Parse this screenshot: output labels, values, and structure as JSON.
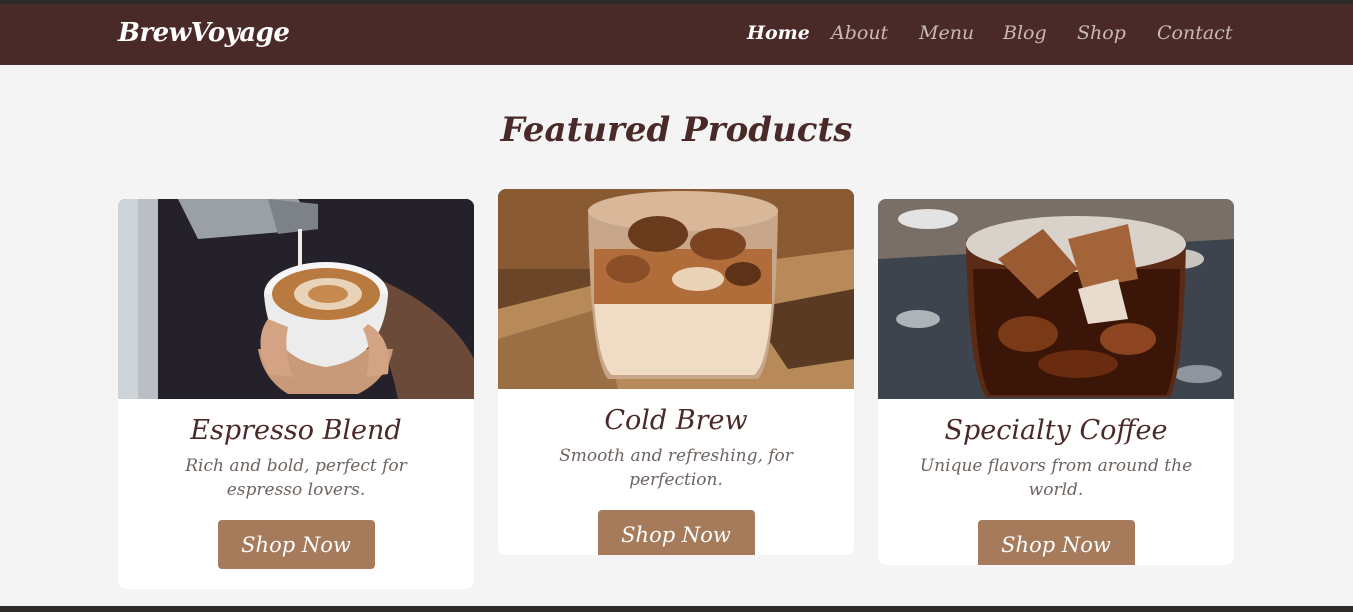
{
  "brand": "BrewVoyage",
  "nav": [
    {
      "label": "Home",
      "active": true
    },
    {
      "label": "About",
      "active": false
    },
    {
      "label": "Menu",
      "active": false
    },
    {
      "label": "Blog",
      "active": false
    },
    {
      "label": "Shop",
      "active": false
    },
    {
      "label": "Contact",
      "active": false
    }
  ],
  "section_title": "Featured Products",
  "products": [
    {
      "title": "Espresso Blend",
      "description": "Rich and bold, perfect for espresso lovers.",
      "button": "Shop Now",
      "image": "latte-art-cup-image"
    },
    {
      "title": "Cold Brew",
      "description": "Smooth and refreshing, for perfection.",
      "button": "Shop Now",
      "image": "iced-coffee-glass-image"
    },
    {
      "title": "Specialty Coffee",
      "description": "Unique flavors from around the world.",
      "button": "Shop Now",
      "image": "iced-americano-glass-image"
    }
  ],
  "colors": {
    "nav_bg": "#4a2a28",
    "accent": "#a67b5b",
    "title": "#4a2a28",
    "page_bg": "#f4f4f4"
  }
}
